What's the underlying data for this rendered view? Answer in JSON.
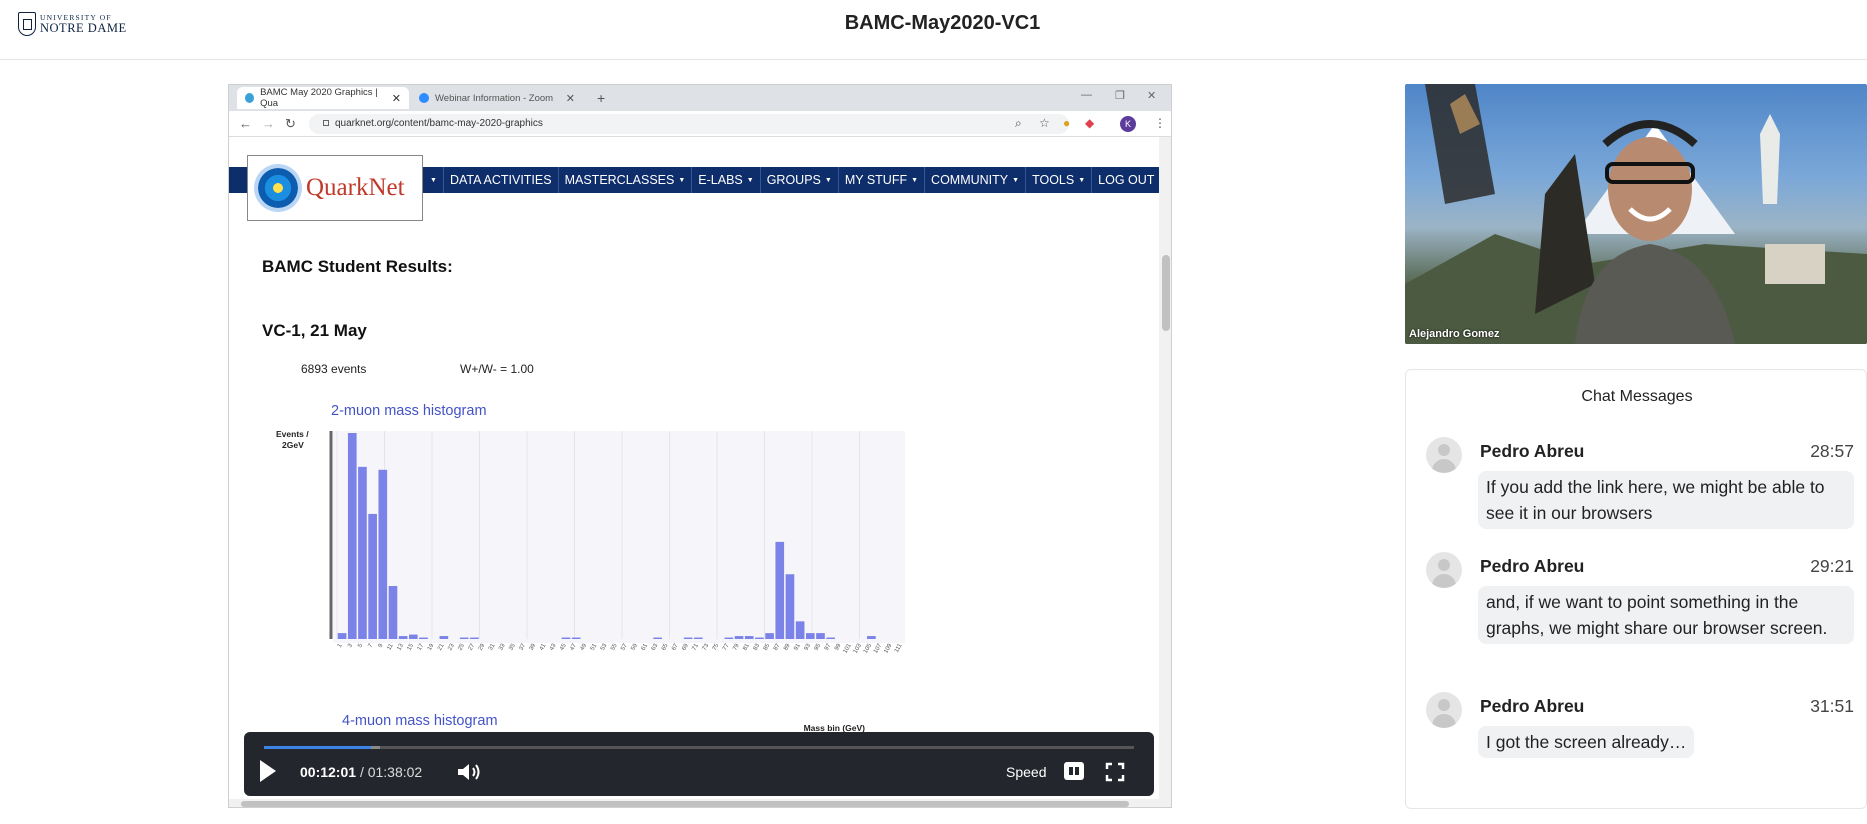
{
  "header": {
    "logo_line1": "UNIVERSITY OF",
    "logo_line2": "NOTRE DAME",
    "title": "BAMC-May2020-VC1"
  },
  "browser": {
    "tabs": [
      {
        "label": "BAMC May 2020 Graphics | Qua"
      },
      {
        "label": "Webinar Information - Zoom"
      }
    ],
    "new_tab_glyph": "+",
    "url": "quarknet.org/content/bamc-may-2020-graphics",
    "profile_initial": "K"
  },
  "webpage": {
    "logo_text": "QuarkNet",
    "nav_items": [
      {
        "label": "DATA ACTIVITIES",
        "dropdown": false
      },
      {
        "label": "MASTERCLASSES",
        "dropdown": true
      },
      {
        "label": "E-LABS",
        "dropdown": true
      },
      {
        "label": "GROUPS",
        "dropdown": true
      },
      {
        "label": "MY STUFF",
        "dropdown": true
      },
      {
        "label": "COMMUNITY",
        "dropdown": true
      },
      {
        "label": "TOOLS",
        "dropdown": true
      },
      {
        "label": "LOG OUT",
        "dropdown": false
      }
    ],
    "heading1": "BAMC Student Results:",
    "heading2": "VC-1, 21 May",
    "events": "6893 events",
    "ratio": "W+/W- = 1.00",
    "histo1_title": "2-muon mass histogram",
    "histo2_title": "4-muon mass histogram"
  },
  "chart_data": {
    "type": "bar",
    "title": "2-muon mass histogram",
    "ylabel": "Events / 2GeV",
    "xlabel": "Mass bin (GeV)",
    "bar_color": "#7b83e8",
    "categories": [
      "1",
      "3",
      "5",
      "7",
      "9",
      "11",
      "13",
      "15",
      "17",
      "19",
      "21",
      "23",
      "25",
      "27",
      "29",
      "31",
      "33",
      "35",
      "37",
      "39",
      "41",
      "43",
      "45",
      "47",
      "49",
      "51",
      "53",
      "55",
      "57",
      "59",
      "61",
      "63",
      "65",
      "67",
      "69",
      "71",
      "73",
      "75",
      "77",
      "79",
      "81",
      "83",
      "85",
      "87",
      "89",
      "91",
      "93",
      "95",
      "97",
      "99",
      "101",
      "103",
      "105",
      "107",
      "109",
      "111"
    ],
    "values": [
      4,
      140,
      117,
      85,
      115,
      36,
      2,
      3,
      1,
      0,
      2,
      0,
      1,
      1,
      0,
      0,
      0,
      0,
      0,
      0,
      0,
      0,
      1,
      1,
      0,
      0,
      0,
      0,
      0,
      0,
      0,
      1,
      0,
      0,
      1,
      1,
      0,
      0,
      1,
      2,
      2,
      1,
      4,
      66,
      44,
      12,
      4,
      4,
      1,
      0,
      0,
      0,
      2,
      0,
      0,
      0
    ],
    "ylim": [
      0,
      140
    ]
  },
  "player": {
    "current_time": "00:12:01",
    "separator": "/",
    "total_time": "01:38:02",
    "speed_label": "Speed",
    "progress": 0.123,
    "buffer_end": 0.122
  },
  "participant": {
    "name": "Alejandro Gomez"
  },
  "chat": {
    "title": "Chat Messages",
    "messages": [
      {
        "name": "Pedro Abreu",
        "time": "28:57",
        "text": "If you add the link here, we might be able to see it in our browsers"
      },
      {
        "name": "Pedro Abreu",
        "time": "29:21",
        "text": "and, if we want to point something in the graphs, we might share our browser screen."
      },
      {
        "name": "Pedro Abreu",
        "time": "31:51",
        "text": "I got the screen already…"
      }
    ]
  }
}
